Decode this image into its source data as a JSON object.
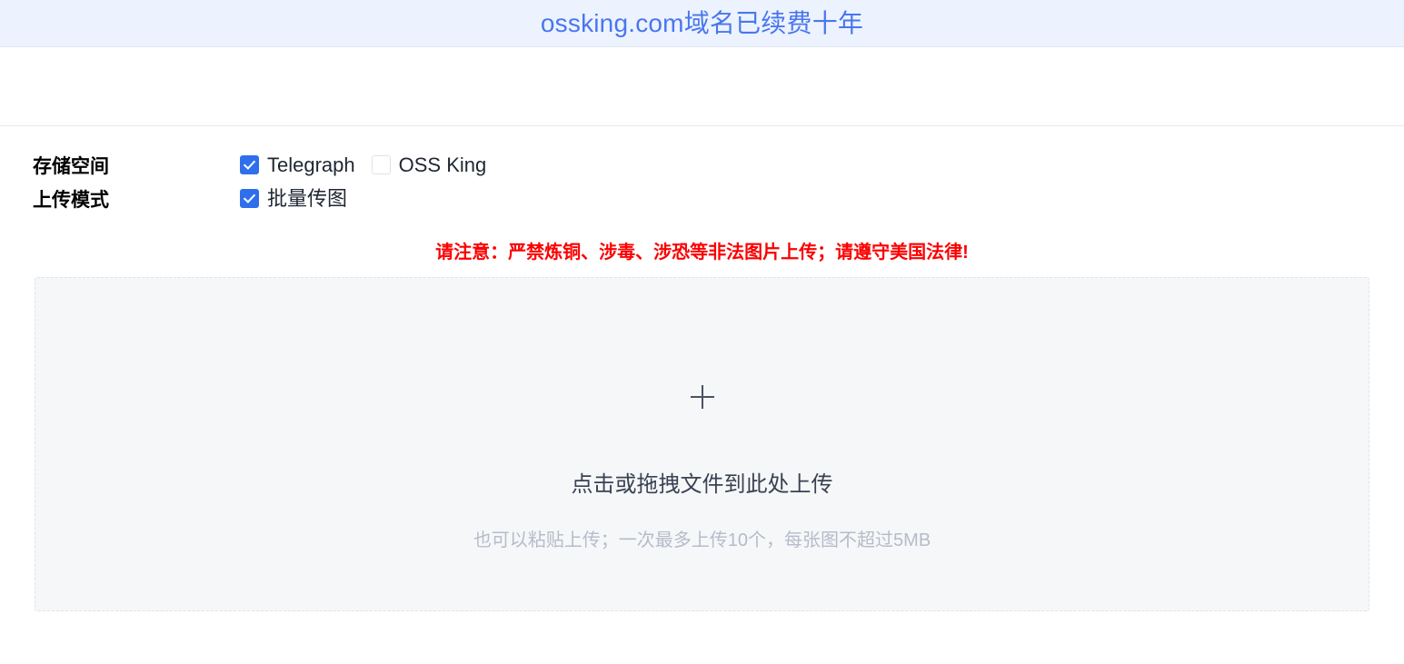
{
  "banner": {
    "text": "ossking.com域名已续费十年",
    "color": "#4a76ee",
    "background": "#ecf3fe"
  },
  "nav": {
    "items": []
  },
  "options": {
    "rows": [
      {
        "label": "存储空间",
        "choices": [
          {
            "label": "Telegraph",
            "checked": true
          },
          {
            "label": "OSS King",
            "checked": false
          }
        ]
      },
      {
        "label": "上传模式",
        "choices": [
          {
            "label": "批量传图",
            "checked": true
          }
        ]
      }
    ],
    "checked_color": "#2f6fec"
  },
  "warning": {
    "text": "请注意：严禁炼铜、涉毒、涉恐等非法图片上传；请遵守美国法律!",
    "color": "#fb0000"
  },
  "dropzone": {
    "icon": "plus-icon",
    "main_text": "点击或拖拽文件到此处上传",
    "hint_text": "也可以粘贴上传；一次最多上传10个，每张图不超过5MB",
    "max_files": "10",
    "max_size": "5MB",
    "background": "#f6f7f9"
  }
}
